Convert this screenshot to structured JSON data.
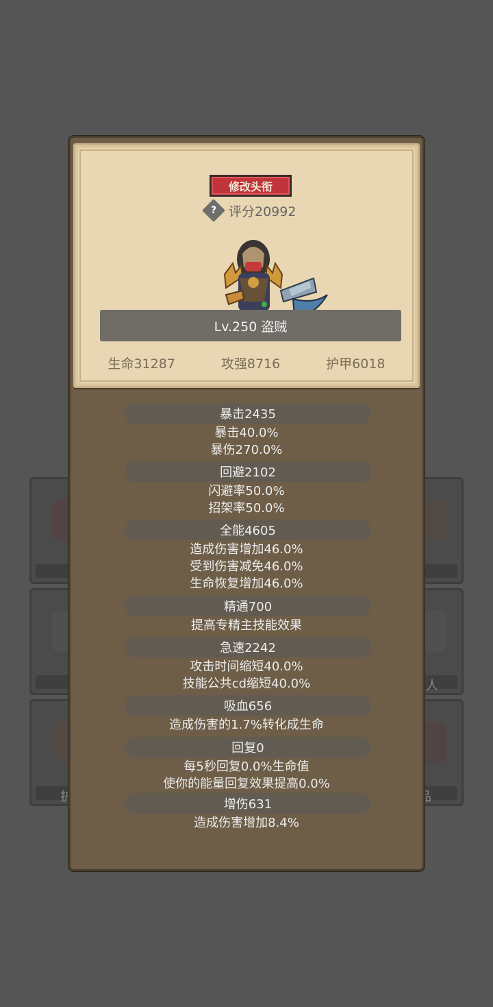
{
  "background": {
    "left_label_1": "护",
    "right_label_1": "人",
    "right_label_2": "品"
  },
  "card": {
    "rename_button": "修改头衔",
    "score": "评分20992",
    "help_icon": "?",
    "level_class": "Lv.250 盗贼",
    "stats": {
      "hp": "生命31287",
      "attack": "攻强8716",
      "armor": "护甲6018"
    }
  },
  "attributes": [
    {
      "title": "暴击2435",
      "lines": [
        "暴击40.0%",
        "暴伤270.0%"
      ]
    },
    {
      "title": "回避2102",
      "lines": [
        "闪避率50.0%",
        "招架率50.0%"
      ]
    },
    {
      "title": "全能4605",
      "lines": [
        "造成伤害增加46.0%",
        "受到伤害减免46.0%",
        "生命恢复增加46.0%"
      ]
    },
    {
      "title": "精通700",
      "lines": [
        "提高专精主技能效果"
      ]
    },
    {
      "title": "急速2242",
      "lines": [
        "攻击时间缩短40.0%",
        "技能公共cd缩短40.0%"
      ]
    },
    {
      "title": "吸血656",
      "lines": [
        "造成伤害的1.7%转化成生命"
      ]
    },
    {
      "title": "回复0",
      "lines": [
        "每5秒回复0.0%生命值",
        "使你的能量回复效果提高0.0%"
      ]
    },
    {
      "title": "增伤631",
      "lines": [
        "造成伤害增加8.4%"
      ]
    }
  ],
  "colors": {
    "accent_red": "#c0343a",
    "panel": "#6e5e48",
    "parchment": "#e9d7b3"
  }
}
